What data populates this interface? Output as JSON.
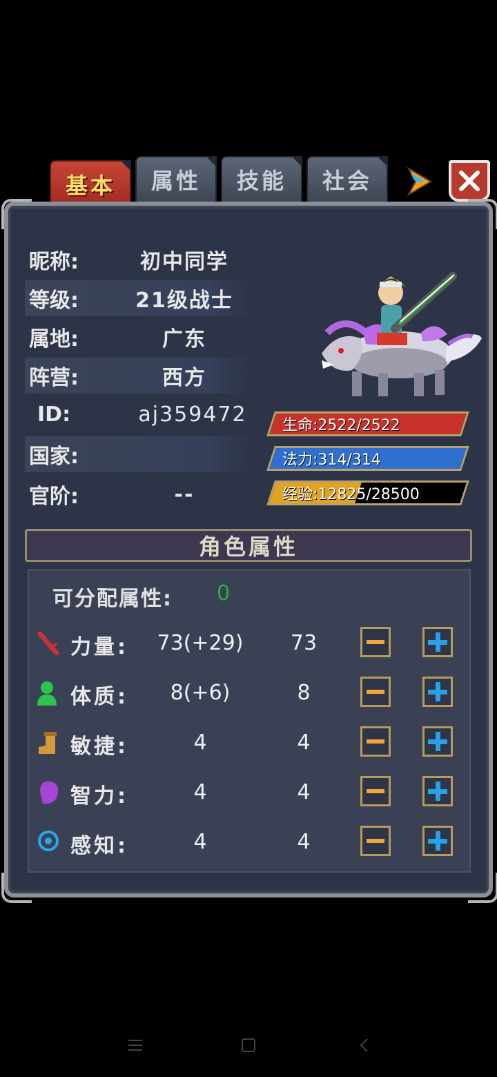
{
  "tabs": [
    {
      "label": "基本",
      "active": true
    },
    {
      "label": "属性",
      "active": false
    },
    {
      "label": "技能",
      "active": false
    },
    {
      "label": "社会",
      "active": false
    }
  ],
  "info": {
    "nickname": {
      "label": "昵称:",
      "value": "初中同学"
    },
    "level": {
      "label": "等级:",
      "value": "21级战士"
    },
    "territory": {
      "label": "属地:",
      "value": "广东"
    },
    "camp": {
      "label": "阵营:",
      "value": "西方"
    },
    "id": {
      "label": "ID:",
      "value": "aj359472"
    },
    "country": {
      "label": "国家:",
      "value": ""
    },
    "rank": {
      "label": "官阶:",
      "value": "--"
    }
  },
  "bars": {
    "hp": {
      "text": "生命:2522/2522",
      "fraction": 1.0,
      "color": "#c8322a"
    },
    "mp": {
      "text": "法力:314/314",
      "fraction": 1.0,
      "color": "#2f6fd0"
    },
    "exp": {
      "text": "经验:12825/28500",
      "fraction": 0.45,
      "color": "#e0a322"
    }
  },
  "attributes": {
    "title": "角色属性",
    "allocatable_label": "可分配属性:",
    "allocatable_value": "0",
    "stats": [
      {
        "name": "力量:",
        "current": "73(+29)",
        "base": "73",
        "icon": "sword-icon"
      },
      {
        "name": "体质:",
        "current": "8(+6)",
        "base": "8",
        "icon": "person-icon"
      },
      {
        "name": "敏捷:",
        "current": "4",
        "base": "4",
        "icon": "boot-icon"
      },
      {
        "name": "智力:",
        "current": "4",
        "base": "4",
        "icon": "head-icon"
      },
      {
        "name": "感知:",
        "current": "4",
        "base": "4",
        "icon": "eye-ring-icon"
      }
    ]
  },
  "colors": {
    "panel": "#2d3447",
    "active_tab": "#b8382c",
    "tab_text_active": "#ffe066",
    "allocatable_value": "#22b536"
  }
}
